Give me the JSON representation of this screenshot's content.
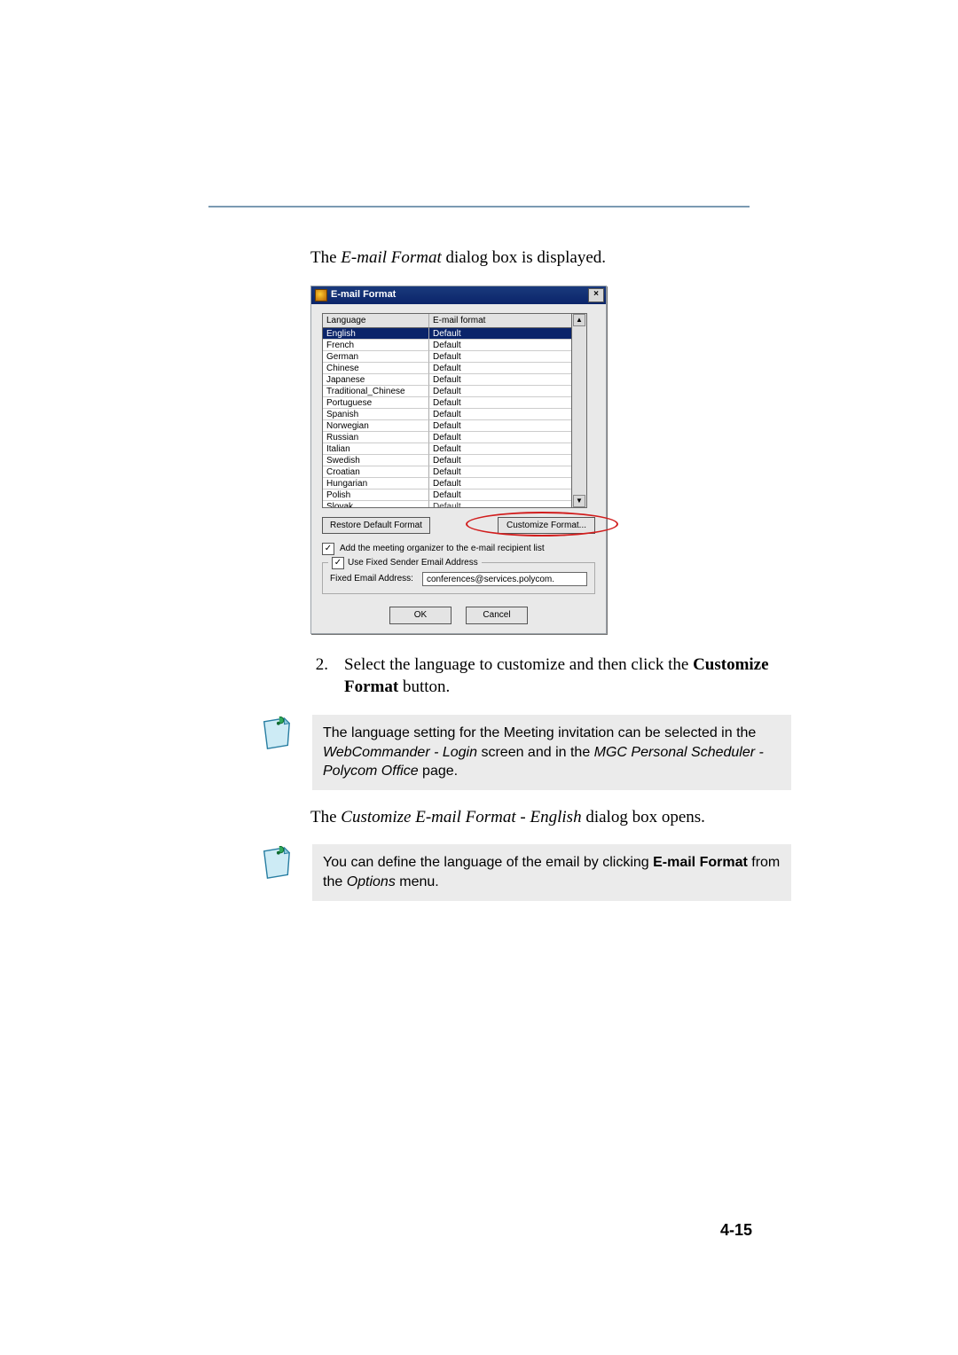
{
  "intro_text_pre": "The ",
  "intro_text_italic": "E-mail Format",
  "intro_text_post": " dialog box is displayed.",
  "dialog": {
    "title": "E-mail Format",
    "close_glyph": "×",
    "header_lang": "Language",
    "header_fmt": "E-mail format",
    "scroll_up": "▲",
    "scroll_down": "▼",
    "rows": [
      {
        "lang": "English",
        "fmt": "Default",
        "selected": true
      },
      {
        "lang": "French",
        "fmt": "Default"
      },
      {
        "lang": "German",
        "fmt": "Default"
      },
      {
        "lang": "Chinese",
        "fmt": "Default"
      },
      {
        "lang": "Japanese",
        "fmt": "Default"
      },
      {
        "lang": "Traditional_Chinese",
        "fmt": "Default"
      },
      {
        "lang": "Portuguese",
        "fmt": "Default"
      },
      {
        "lang": "Spanish",
        "fmt": "Default"
      },
      {
        "lang": "Norwegian",
        "fmt": "Default"
      },
      {
        "lang": "Russian",
        "fmt": "Default"
      },
      {
        "lang": "Italian",
        "fmt": "Default"
      },
      {
        "lang": "Swedish",
        "fmt": "Default"
      },
      {
        "lang": "Croatian",
        "fmt": "Default"
      },
      {
        "lang": "Hungarian",
        "fmt": "Default"
      },
      {
        "lang": "Polish",
        "fmt": "Default"
      },
      {
        "lang": "Slovak",
        "fmt": "Default",
        "partial": true
      }
    ],
    "restore_btn": "Restore Default Format",
    "customize_btn": "Customize Format...",
    "chk_meeting": "Add the meeting organizer to the e-mail recipient list",
    "chk_fixed_sender": "Use Fixed Sender Email Address",
    "fixed_label": "Fixed Email Address:",
    "fixed_value": "conferences@services.polycom.",
    "ok_btn": "OK",
    "cancel_btn": "Cancel",
    "check_glyph": "✓"
  },
  "step": {
    "num": "2.",
    "text_a": "Select the language to customize and then click the ",
    "text_bold": "Customize Format",
    "text_b": " button."
  },
  "note1": {
    "line1": "The language setting for the Meeting invitation can be selected in the ",
    "italic1": "WebCommander - Login",
    "mid1": " screen and in the ",
    "italic2": "MGC Personal Scheduler - Polycom Office",
    "tail": " page."
  },
  "sec": {
    "pre": "The ",
    "italic": "Customize E-mail Format - English",
    "post": " dialog box opens."
  },
  "note2": {
    "line_a": "You can define the language of the email by clicking ",
    "bold": "E-mail Format",
    "line_b": " from the ",
    "italic": "Options",
    "tail": " menu."
  },
  "page_number": "4-15"
}
